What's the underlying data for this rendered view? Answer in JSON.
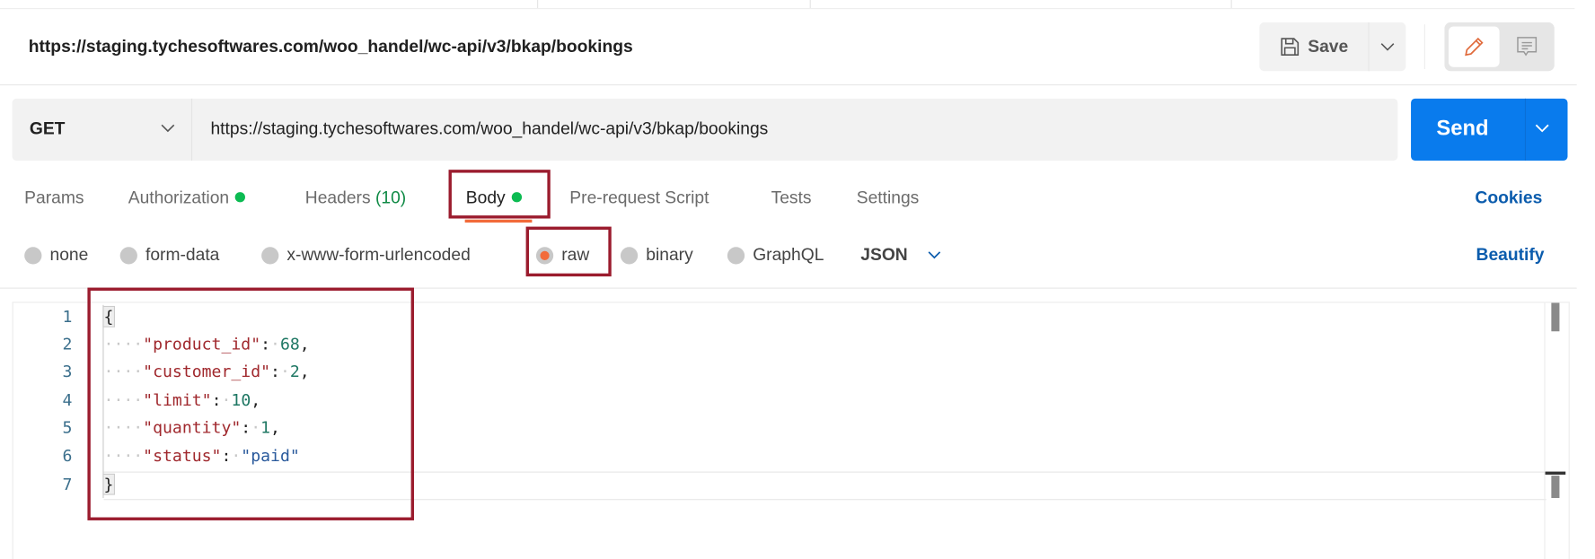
{
  "header": {
    "title": "https://staging.tychesoftwares.com/woo_handel/wc-api/v3/bkap/bookings",
    "save_label": "Save"
  },
  "request": {
    "method": "GET",
    "url": "https://staging.tychesoftwares.com/woo_handel/wc-api/v3/bkap/bookings",
    "send_label": "Send"
  },
  "tabs": {
    "items": [
      {
        "label": "Params"
      },
      {
        "label": "Authorization"
      },
      {
        "label": "Headers",
        "count": "(10)"
      },
      {
        "label": "Body"
      },
      {
        "label": "Pre-request Script"
      },
      {
        "label": "Tests"
      },
      {
        "label": "Settings"
      }
    ],
    "active": "Body",
    "cookies": "Cookies"
  },
  "body_types": {
    "items": [
      {
        "label": "none"
      },
      {
        "label": "form-data"
      },
      {
        "label": "x-www-form-urlencoded"
      },
      {
        "label": "raw"
      },
      {
        "label": "binary"
      },
      {
        "label": "GraphQL"
      }
    ],
    "selected": "raw",
    "format": "JSON",
    "beautify": "Beautify"
  },
  "editor": {
    "line_numbers": [
      "1",
      "2",
      "3",
      "4",
      "5",
      "6",
      "7"
    ],
    "lines": [
      {
        "open": "{"
      },
      {
        "key": "\"product_id\"",
        "value": "68",
        "comma": ","
      },
      {
        "key": "\"customer_id\"",
        "value": "2",
        "comma": ","
      },
      {
        "key": "\"limit\"",
        "value": "10",
        "comma": ","
      },
      {
        "key": "\"quantity\"",
        "value": "1",
        "comma": ","
      },
      {
        "key": "\"status\"",
        "value": "\"paid\"",
        "comma": ""
      },
      {
        "close": "}"
      }
    ]
  },
  "colors": {
    "accent": "#097bed",
    "link": "#0b5cad",
    "status_dot": "#0cbb52",
    "active_tab_underline": "#f26b3a",
    "highlight_box": "#9b1c2e"
  }
}
